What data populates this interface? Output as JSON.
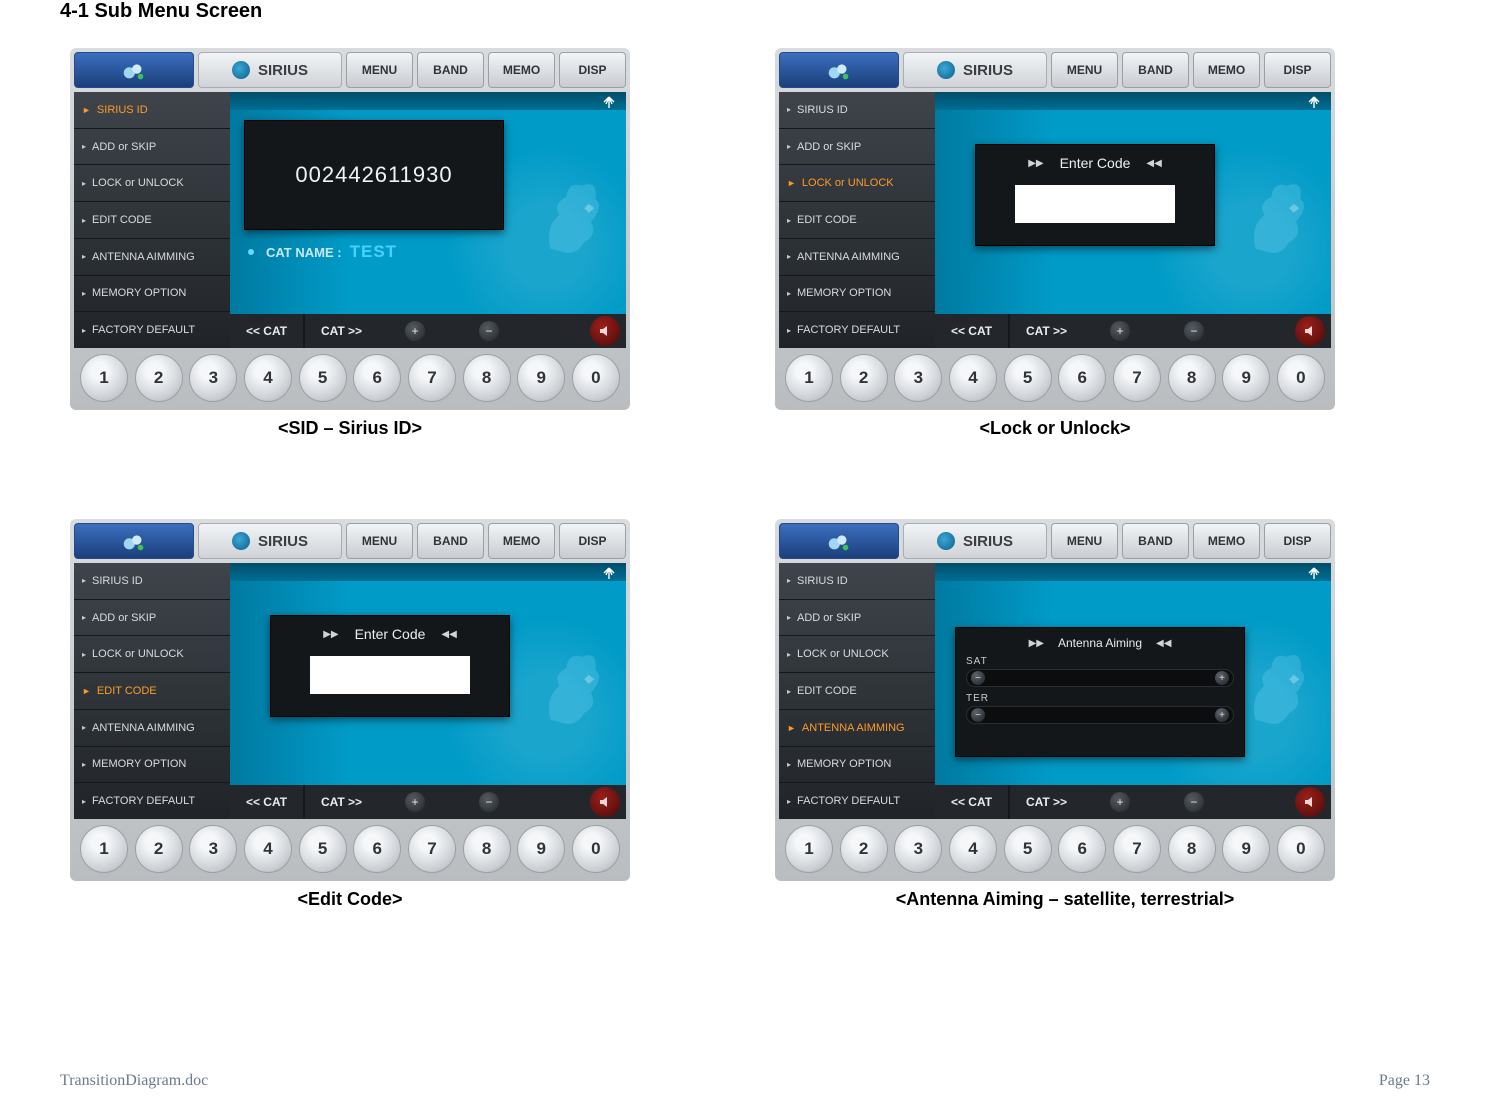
{
  "page_title": "4-1 Sub Menu Screen",
  "footer": {
    "file": "TransitionDiagram.doc",
    "page": "Page 13"
  },
  "common": {
    "sirius_label": "SIRIUS",
    "topbuttons": [
      "MENU",
      "BAND",
      "MEMO",
      "DISP"
    ],
    "menu_items": [
      "SIRIUS ID",
      "ADD or SKIP",
      "LOCK or UNLOCK",
      "EDIT CODE",
      "ANTENNA AIMMING",
      "MEMORY OPTION",
      "FACTORY DEFAULT"
    ],
    "cat_prev": "<< CAT",
    "cat_next": "CAT >>",
    "numbers": [
      "1",
      "2",
      "3",
      "4",
      "5",
      "6",
      "7",
      "8",
      "9",
      "0"
    ]
  },
  "panels": {
    "sid": {
      "caption": "<SID – Sirius ID>",
      "selected_index": 0,
      "value": "002442611930",
      "cat_label": "CAT NAME :",
      "cat_value": "TEST"
    },
    "lock": {
      "caption": "<Lock or Unlock>",
      "selected_index": 2,
      "box_title": "Enter Code"
    },
    "edit": {
      "caption": "<Edit Code>",
      "selected_index": 3,
      "box_title": "Enter Code"
    },
    "aim": {
      "caption": "<Antenna Aiming – satellite, terrestrial>",
      "selected_index": 4,
      "box_title": "Antenna Aiming",
      "sat_label": "SAT",
      "ter_label": "TER"
    }
  }
}
